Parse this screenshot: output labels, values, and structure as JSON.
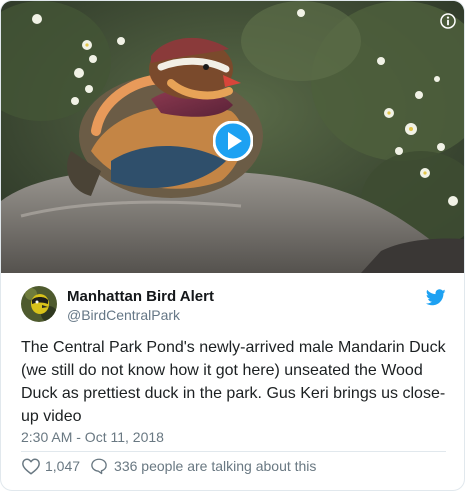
{
  "media": {
    "type": "video",
    "play_icon": "play-circle-icon",
    "info_icon": "info-icon"
  },
  "author": {
    "name": "Manhattan Bird Alert",
    "handle": "@BirdCentralPark",
    "avatar": "avatar-bird"
  },
  "brand": {
    "logo": "twitter-bird-icon",
    "color": "#1da1f2"
  },
  "tweet": {
    "text": "The Central Park Pond's newly-arrived male Mandarin Duck (we still do not know how it got here) unseated the Wood Duck as prettiest duck in the park. Gus Keri brings us close-up video",
    "timestamp": "2:30 AM - Oct 11, 2018"
  },
  "engagement": {
    "like_icon": "heart-icon",
    "like_count": "1,047",
    "reply_icon": "speech-bubble-icon",
    "talking_text": "336 people are talking about this"
  }
}
